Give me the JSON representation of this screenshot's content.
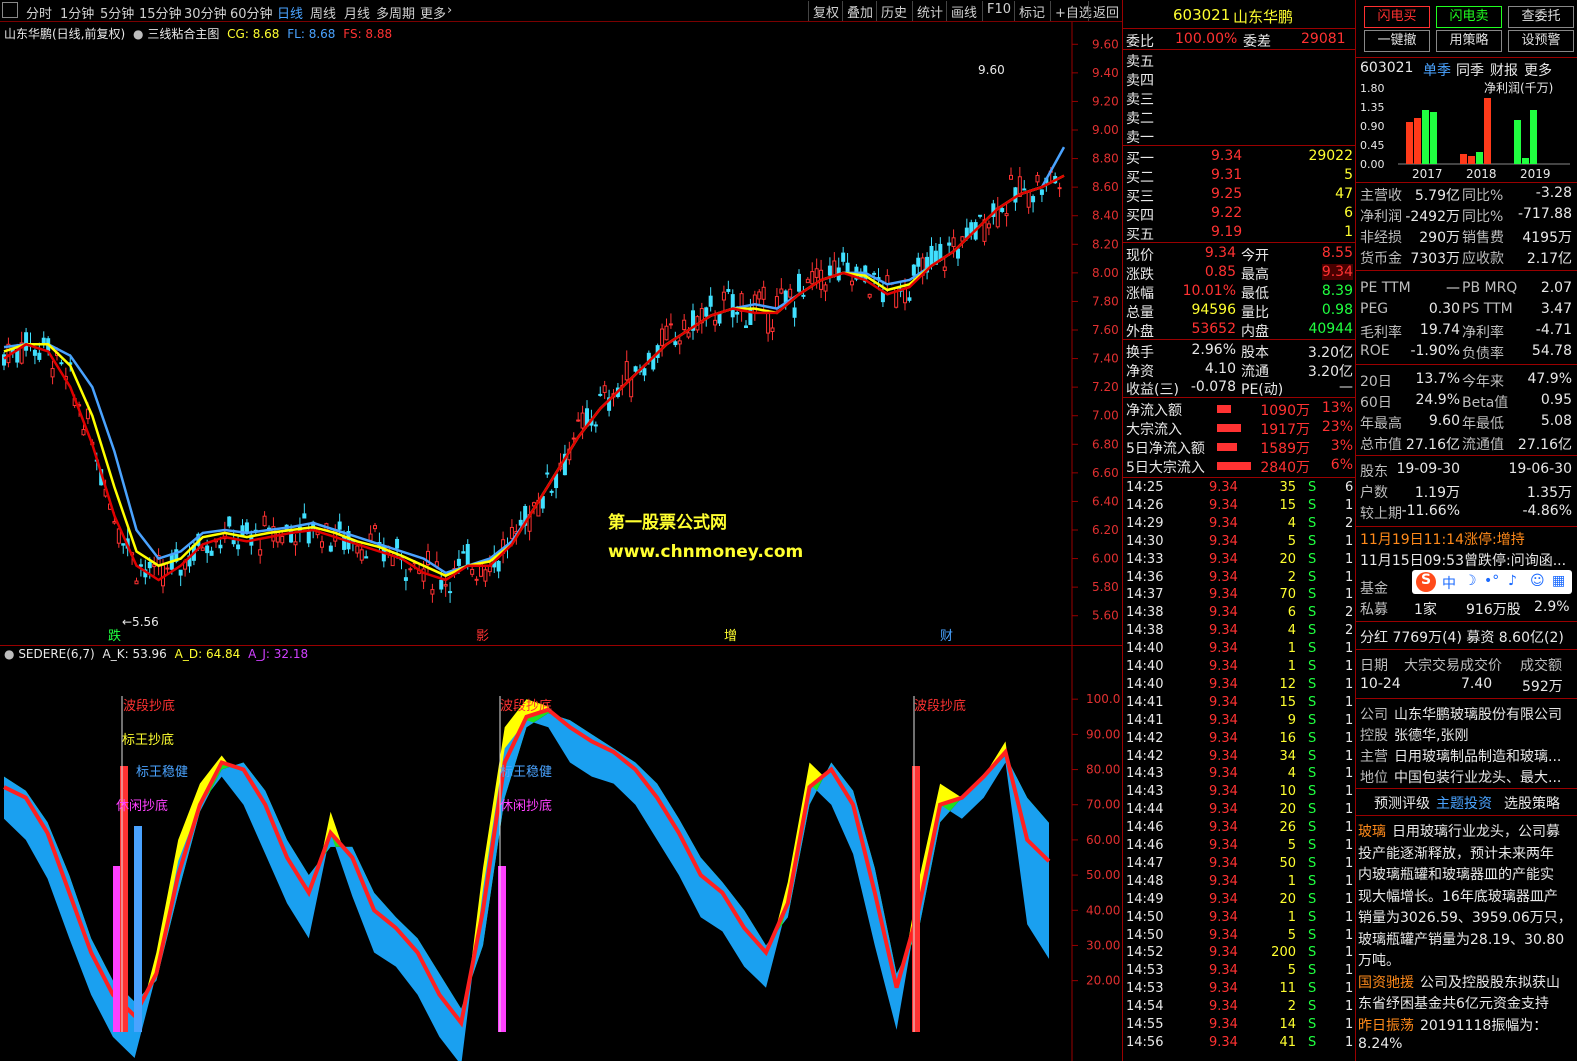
{
  "toolbar": {
    "periods": [
      "分时",
      "1分钟",
      "5分钟",
      "15分钟",
      "30分钟",
      "60分钟",
      "日线",
      "周线",
      "月线",
      "多周期",
      "更多"
    ],
    "active_period": "日线",
    "buttons": [
      "复权",
      "叠加",
      "历史",
      "统计",
      "画线",
      "F10",
      "标记",
      "+自选",
      "返回"
    ]
  },
  "main_chart": {
    "title": "山东华鹏(日线,前复权)",
    "indicator_name": "三线粘合主图",
    "cg_label": "CG: 8.68",
    "fl_label": "FL: 8.68",
    "fs_label": "FS: 8.88",
    "high_label": "9.60",
    "low_label": "5.56",
    "watermark1": "第一股票公式网",
    "watermark2": "www.chnmoney.com",
    "markers": [
      "跌",
      "影",
      "增",
      "财"
    ],
    "y_ticks": [
      "9.60",
      "9.40",
      "9.20",
      "9.00",
      "8.80",
      "8.60",
      "8.40",
      "8.20",
      "8.00",
      "7.80",
      "7.60",
      "7.40",
      "7.20",
      "7.00",
      "6.80",
      "6.60",
      "6.40",
      "6.20",
      "6.00",
      "5.80",
      "5.60"
    ]
  },
  "indicator": {
    "name": "SEDERE(6,7)",
    "a_k": "A_K: 53.96",
    "a_d": "A_D: 64.84",
    "a_j": "A_J: 32.18",
    "y_ticks": [
      "100.0",
      "90.00",
      "80.00",
      "70.00",
      "60.00",
      "50.00",
      "40.00",
      "30.00",
      "20.00"
    ],
    "signals": [
      "波段抄底",
      "标王抄底",
      "标王稳健",
      "休闲抄底",
      "波段抄底",
      "标王稳健",
      "休闲抄底",
      "波段抄底"
    ]
  },
  "quote": {
    "code": "603021",
    "name": "山东华鹏",
    "weibi_label": "委比",
    "weibi": "100.00%",
    "weicha_label": "委差",
    "weicha": "29081",
    "asks": [
      "卖五",
      "卖四",
      "卖三",
      "卖二",
      "卖一"
    ],
    "bids": [
      {
        "label": "买一",
        "price": "9.34",
        "vol": "29022"
      },
      {
        "label": "买二",
        "price": "9.31",
        "vol": "5"
      },
      {
        "label": "买三",
        "price": "9.25",
        "vol": "47"
      },
      {
        "label": "买四",
        "price": "9.22",
        "vol": "6"
      },
      {
        "label": "买五",
        "price": "9.19",
        "vol": "1"
      }
    ],
    "stats": [
      {
        "l1": "现价",
        "v1": "9.34",
        "l2": "今开",
        "v2": "8.55"
      },
      {
        "l1": "涨跌",
        "v1": "0.85",
        "l2": "最高",
        "v2": "9.34"
      },
      {
        "l1": "涨幅",
        "v1": "10.01%",
        "l2": "最低",
        "v2": "8.39"
      },
      {
        "l1": "总量",
        "v1": "94596",
        "l2": "量比",
        "v2": "0.98"
      },
      {
        "l1": "外盘",
        "v1": "53652",
        "l2": "内盘",
        "v2": "40944"
      },
      {
        "l1": "换手",
        "v1": "2.96%",
        "l2": "股本",
        "v2": "3.20亿"
      },
      {
        "l1": "净资",
        "v1": "4.10",
        "l2": "流通",
        "v2": "3.20亿"
      },
      {
        "l1": "收益(三)",
        "v1": "-0.078",
        "l2": "PE(动)",
        "v2": "—"
      }
    ],
    "flows": [
      {
        "label": "净流入额",
        "amount": "1090万",
        "pct": "13%"
      },
      {
        "label": "大宗流入",
        "amount": "1917万",
        "pct": "23%"
      },
      {
        "label": "5日净流入额",
        "amount": "1589万",
        "pct": "3%"
      },
      {
        "label": "5日大宗流入",
        "amount": "2840万",
        "pct": "6%"
      }
    ],
    "ticks": [
      [
        "14:25",
        "9.34",
        "35",
        "S",
        "6"
      ],
      [
        "14:26",
        "9.34",
        "15",
        "S",
        "1"
      ],
      [
        "14:29",
        "9.34",
        "4",
        "S",
        "2"
      ],
      [
        "14:30",
        "9.34",
        "5",
        "S",
        "1"
      ],
      [
        "14:33",
        "9.34",
        "20",
        "S",
        "1"
      ],
      [
        "14:36",
        "9.34",
        "2",
        "S",
        "1"
      ],
      [
        "14:37",
        "9.34",
        "70",
        "S",
        "1"
      ],
      [
        "14:38",
        "9.34",
        "6",
        "S",
        "2"
      ],
      [
        "14:38",
        "9.34",
        "4",
        "S",
        "2"
      ],
      [
        "14:40",
        "9.34",
        "1",
        "S",
        "1"
      ],
      [
        "14:40",
        "9.34",
        "1",
        "S",
        "1"
      ],
      [
        "14:40",
        "9.34",
        "12",
        "S",
        "1"
      ],
      [
        "14:41",
        "9.34",
        "15",
        "S",
        "1"
      ],
      [
        "14:41",
        "9.34",
        "9",
        "S",
        "1"
      ],
      [
        "14:42",
        "9.34",
        "16",
        "S",
        "1"
      ],
      [
        "14:42",
        "9.34",
        "34",
        "S",
        "1"
      ],
      [
        "14:43",
        "9.34",
        "4",
        "S",
        "1"
      ],
      [
        "14:43",
        "9.34",
        "10",
        "S",
        "1"
      ],
      [
        "14:44",
        "9.34",
        "20",
        "S",
        "1"
      ],
      [
        "14:46",
        "9.34",
        "26",
        "S",
        "1"
      ],
      [
        "14:46",
        "9.34",
        "5",
        "S",
        "1"
      ],
      [
        "14:47",
        "9.34",
        "50",
        "S",
        "1"
      ],
      [
        "14:48",
        "9.34",
        "1",
        "S",
        "1"
      ],
      [
        "14:49",
        "9.34",
        "20",
        "S",
        "1"
      ],
      [
        "14:50",
        "9.34",
        "1",
        "S",
        "1"
      ],
      [
        "14:50",
        "9.34",
        "5",
        "S",
        "1"
      ],
      [
        "14:52",
        "9.34",
        "200",
        "S",
        "1"
      ],
      [
        "14:53",
        "9.34",
        "5",
        "S",
        "1"
      ],
      [
        "14:53",
        "9.34",
        "11",
        "S",
        "1"
      ],
      [
        "14:54",
        "9.34",
        "2",
        "S",
        "1"
      ],
      [
        "14:55",
        "9.34",
        "14",
        "S",
        "1"
      ],
      [
        "14:56",
        "9.34",
        "41",
        "S",
        "1"
      ]
    ]
  },
  "info": {
    "buttons": [
      "闪电买",
      "闪电卖",
      "查委托",
      "一键撤",
      "用策略",
      "设预警"
    ],
    "code": "603021",
    "tabs": [
      "单季",
      "同季",
      "财报",
      "更多"
    ],
    "net_profit_label": "净利润(千万)",
    "bar_y_ticks": [
      "1.80",
      "1.35",
      "0.90",
      "0.45",
      "0.00"
    ],
    "bar_years": [
      "2017",
      "2018",
      "2019"
    ],
    "fin": [
      {
        "l1": "主营收",
        "v1": "5.79亿",
        "l2": "同比%",
        "v2": "-3.28"
      },
      {
        "l1": "净利润",
        "v1": "-2492万",
        "l2": "同比%",
        "v2": "-717.88"
      },
      {
        "l1": "非经损",
        "v1": "290万",
        "l2": "销售费",
        "v2": "4195万"
      },
      {
        "l1": "货币金",
        "v1": "7303万",
        "l2": "应收款",
        "v2": "2.17亿"
      },
      {
        "l1": "PE TTM",
        "v1": "—",
        "l2": "PB MRQ",
        "v2": "2.07"
      },
      {
        "l1": "PEG",
        "v1": "0.30",
        "l2": "PS TTM",
        "v2": "3.47"
      },
      {
        "l1": "毛利率",
        "v1": "19.74",
        "l2": "净利率",
        "v2": "-4.71"
      },
      {
        "l1": "ROE",
        "v1": "-1.90%",
        "l2": "负债率",
        "v2": "54.78"
      },
      {
        "l1": "20日",
        "v1": "13.7%",
        "l2": "今年来",
        "v2": "47.9%"
      },
      {
        "l1": "60日",
        "v1": "24.9%",
        "l2": "Beta值",
        "v2": "0.95"
      },
      {
        "l1": "年最高",
        "v1": "9.60",
        "l2": "年最低",
        "v2": "5.08"
      },
      {
        "l1": "总市值",
        "v1": "27.16亿",
        "l2": "流通值",
        "v2": "27.16亿"
      },
      {
        "l1": "股东",
        "v1": "19-09-30",
        "l2": "",
        "v2": "19-06-30"
      },
      {
        "l1": "户数",
        "v1": "1.19万",
        "l2": "",
        "v2": "1.35万"
      },
      {
        "l1": "较上期",
        "v1": "-11.66%",
        "l2": "",
        "v2": "-4.86%"
      }
    ],
    "news1": "11月19日11:14涨停:增持",
    "news2": "11月15日09:53曾跌停:问询函...",
    "fund_label": "基金",
    "private_label": "私募",
    "private_count": "1家",
    "private_shares": "916万股",
    "private_pct": "2.9%",
    "dividend": "分红 7769万(4) 募资 8.60亿(2)",
    "block_header": [
      "日期",
      "大宗交易成交价",
      "成交额"
    ],
    "block_row": [
      "10-24",
      "7.40",
      "592万"
    ],
    "company": [
      {
        "l": "公司",
        "v": "山东华鹏玻璃股份有限公司"
      },
      {
        "l": "控股",
        "v": "张德华,张刚"
      },
      {
        "l": "主营",
        "v": "日用玻璃制品制造和玻璃..."
      },
      {
        "l": "地位",
        "v": "中国包装行业龙头、最大..."
      }
    ],
    "bottom_tabs": [
      "预测评级",
      "主题投资",
      "选股策略"
    ],
    "theme_text": [
      {
        "tag": "玻璃",
        "text": "日用玻璃行业龙头，公司募"
      },
      {
        "tag": "",
        "text": "投产能逐渐释放，预计未来两年"
      },
      {
        "tag": "",
        "text": "内玻璃瓶罐和玻璃器皿的产能实"
      },
      {
        "tag": "",
        "text": "现大幅增长。16年底玻璃器皿产"
      },
      {
        "tag": "",
        "text": "销量为3026.59、3959.06万只，"
      },
      {
        "tag": "",
        "text": "玻璃瓶罐产销量为28.19、30.80"
      },
      {
        "tag": "",
        "text": "万吨。"
      },
      {
        "tag": "国资驰援",
        "text": "公司及控股股东拟获山"
      },
      {
        "tag": "",
        "text": "东省纾困基金共6亿元资金支持"
      },
      {
        "tag": "昨日振荡",
        "text": "20191118振幅为："
      },
      {
        "tag": "",
        "text": "8.24%"
      }
    ],
    "ime": "中"
  },
  "colors": {
    "up": "#ff3232",
    "down": "#40e0ff",
    "fl": "#ffff00",
    "fs": "#4aa3ff",
    "cg": "#e00000"
  },
  "chart_data": [
    {
      "type": "line",
      "title": "三线粘合主图",
      "x": [
        0,
        5,
        10,
        15,
        20,
        25,
        30,
        35,
        40,
        45,
        50,
        55,
        60,
        65,
        70,
        75,
        80,
        85,
        90,
        95,
        100,
        105,
        110,
        115,
        120,
        125,
        130,
        135,
        140,
        145,
        150,
        155,
        160,
        165,
        170,
        175,
        180,
        185,
        190,
        195,
        200,
        205,
        210,
        215,
        220,
        225,
        230,
        235,
        240
      ],
      "series": [
        {
          "name": "CG",
          "values": [
            7.4,
            7.5,
            7.45,
            7.2,
            6.8,
            6.3,
            5.95,
            5.85,
            5.95,
            6.1,
            6.15,
            6.12,
            6.15,
            6.18,
            6.2,
            6.15,
            6.1,
            6.05,
            6.0,
            5.9,
            5.85,
            5.95,
            5.95,
            6.1,
            6.35,
            6.6,
            6.85,
            7.05,
            7.2,
            7.35,
            7.5,
            7.6,
            7.7,
            7.75,
            7.72,
            7.72,
            7.85,
            7.95,
            8.0,
            7.95,
            7.85,
            7.9,
            8.05,
            8.15,
            8.3,
            8.45,
            8.55,
            8.6,
            8.68
          ]
        },
        {
          "name": "FL",
          "values": [
            7.45,
            7.5,
            7.5,
            7.35,
            7.0,
            6.5,
            6.05,
            5.95,
            6.0,
            6.15,
            6.18,
            6.15,
            6.18,
            6.2,
            6.22,
            6.18,
            6.12,
            6.08,
            6.02,
            5.95,
            5.88,
            5.95,
            5.98,
            6.1,
            6.35,
            6.6,
            6.85,
            7.05,
            7.2,
            7.35,
            7.5,
            7.6,
            7.7,
            7.75,
            7.75,
            7.72,
            7.85,
            7.95,
            8.0,
            7.98,
            7.88,
            7.92,
            8.05,
            8.15,
            8.3,
            8.45,
            8.55,
            8.6,
            8.68
          ]
        },
        {
          "name": "FS",
          "values": [
            7.48,
            7.5,
            7.5,
            7.42,
            7.2,
            6.75,
            6.2,
            6.0,
            6.05,
            6.18,
            6.2,
            6.18,
            6.2,
            6.22,
            6.25,
            6.2,
            6.15,
            6.1,
            6.05,
            6.0,
            5.9,
            5.95,
            6.0,
            6.12,
            6.35,
            6.6,
            6.85,
            7.05,
            7.2,
            7.35,
            7.5,
            7.6,
            7.7,
            7.75,
            7.78,
            7.75,
            7.85,
            7.95,
            8.0,
            8.0,
            7.92,
            7.95,
            8.05,
            8.15,
            8.3,
            8.45,
            8.55,
            8.6,
            8.88
          ]
        }
      ],
      "ylim": [
        5.5,
        9.7
      ]
    },
    {
      "type": "area",
      "title": "SEDERE(6,7)",
      "series": [
        {
          "name": "A_K",
          "values": [
            75,
            72,
            62,
            45,
            28,
            16,
            10,
            22,
            50,
            70,
            82,
            80,
            70,
            55,
            45,
            62,
            55,
            40,
            35,
            28,
            16,
            8,
            40,
            82,
            95,
            97,
            92,
            88,
            85,
            80,
            72,
            62,
            50,
            45,
            35,
            28,
            42,
            75,
            80,
            70,
            45,
            18,
            40,
            70,
            72,
            78,
            85,
            60,
            53.96
          ]
        },
        {
          "name": "A_D",
          "values": [
            78,
            74,
            65,
            50,
            32,
            20,
            14,
            20,
            45,
            68,
            80,
            82,
            74,
            60,
            50,
            58,
            58,
            45,
            38,
            32,
            22,
            12,
            30,
            72,
            92,
            96,
            94,
            90,
            86,
            82,
            76,
            66,
            55,
            48,
            40,
            30,
            38,
            70,
            82,
            74,
            52,
            22,
            34,
            65,
            72,
            78,
            84,
            72,
            64.84
          ]
        },
        {
          "name": "A_J",
          "values": [
            72,
            66,
            55,
            38,
            22,
            10,
            4,
            28,
            60,
            76,
            84,
            76,
            62,
            48,
            38,
            68,
            50,
            34,
            30,
            22,
            10,
            2,
            52,
            92,
            100,
            98,
            88,
            84,
            82,
            76,
            66,
            56,
            44,
            40,
            30,
            24,
            48,
            82,
            76,
            62,
            36,
            12,
            48,
            76,
            72,
            78,
            88,
            42,
            32.18
          ]
        }
      ],
      "ylim": [
        0,
        110
      ]
    }
  ]
}
